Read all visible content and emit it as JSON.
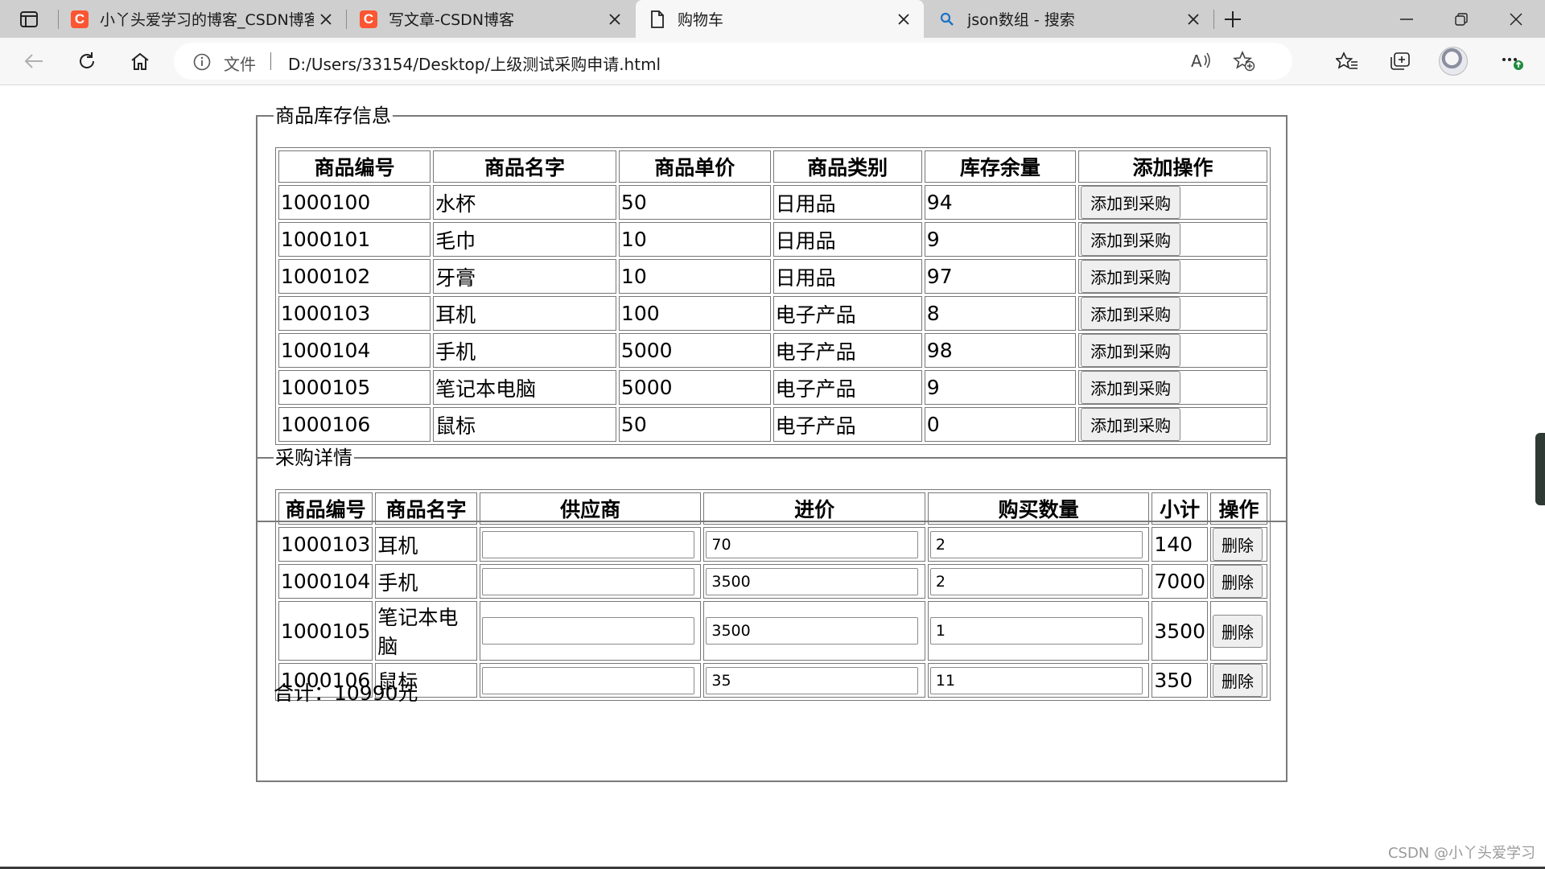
{
  "browser": {
    "tabs": [
      {
        "title": "小丫头爱学习的博客_CSDN博客",
        "icon": "csdn-icon"
      },
      {
        "title": "写文章-CSDN博客",
        "icon": "csdn-icon"
      },
      {
        "title": "购物车",
        "icon": "document-icon"
      },
      {
        "title": "json数组 - 搜索",
        "icon": "search-icon"
      }
    ],
    "address": {
      "scheme_label": "文件",
      "url": "D:/Users/33154/Desktop/上级测试采购申请.html"
    },
    "colors": {
      "csdn_brand": "#fc5531",
      "tabstrip": "#cfcfcf",
      "toolbar": "#f7f7f7"
    }
  },
  "inventory": {
    "legend": "商品库存信息",
    "headers": [
      "商品编号",
      "商品名字",
      "商品单价",
      "商品类别",
      "库存余量",
      "添加操作"
    ],
    "add_label": "添加到采购",
    "rows": [
      {
        "id": "1000100",
        "name": "水杯",
        "price": "50",
        "category": "日用品",
        "stock": "94"
      },
      {
        "id": "1000101",
        "name": "毛巾",
        "price": "10",
        "category": "日用品",
        "stock": "9"
      },
      {
        "id": "1000102",
        "name": "牙膏",
        "price": "10",
        "category": "日用品",
        "stock": "97"
      },
      {
        "id": "1000103",
        "name": "耳机",
        "price": "100",
        "category": "电子产品",
        "stock": "8"
      },
      {
        "id": "1000104",
        "name": "手机",
        "price": "5000",
        "category": "电子产品",
        "stock": "98"
      },
      {
        "id": "1000105",
        "name": "笔记本电脑",
        "price": "5000",
        "category": "电子产品",
        "stock": "9"
      },
      {
        "id": "1000106",
        "name": "鼠标",
        "price": "50",
        "category": "电子产品",
        "stock": "0"
      }
    ]
  },
  "purchase": {
    "legend": "采购详情",
    "headers": [
      "商品编号",
      "商品名字",
      "供应商",
      "进价",
      "购买数量",
      "小计",
      "操作"
    ],
    "delete_label": "删除",
    "rows": [
      {
        "id": "1000103",
        "name": "耳机",
        "supplier": "",
        "cost": "70",
        "qty": "2",
        "subtotal": "140"
      },
      {
        "id": "1000104",
        "name": "手机",
        "supplier": "",
        "cost": "3500",
        "qty": "2",
        "subtotal": "7000"
      },
      {
        "id": "1000105",
        "name": "笔记本电脑",
        "supplier": "",
        "cost": "3500",
        "qty": "1",
        "subtotal": "3500"
      },
      {
        "id": "1000106",
        "name": "鼠标",
        "supplier": "",
        "cost": "35",
        "qty": "11",
        "subtotal": "350"
      }
    ],
    "total_text": "合计：10990元"
  },
  "watermark": "CSDN @小丫头爱学习"
}
